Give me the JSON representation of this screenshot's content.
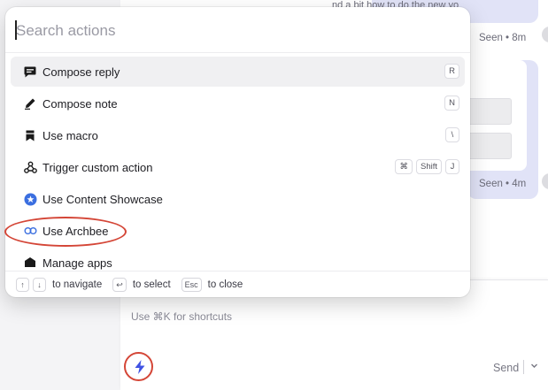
{
  "background": {
    "message_top_text": "nd a bit how to do the new yo",
    "seen_1": "Seen • 8m",
    "seen_2": "Seen • 4m",
    "composer_hint": "Use ⌘K for shortcuts",
    "send_label": "Send",
    "accent_color": "#3f52e3"
  },
  "palette": {
    "search_placeholder": "Search actions",
    "items": [
      {
        "label": "Compose reply",
        "icon": "compose-reply-icon",
        "keys": [
          "R"
        ]
      },
      {
        "label": "Compose note",
        "icon": "compose-note-icon",
        "keys": [
          "N"
        ]
      },
      {
        "label": "Use macro",
        "icon": "bookmark-icon",
        "keys": [
          "\\"
        ]
      },
      {
        "label": "Trigger custom action",
        "icon": "webhook-icon",
        "keys": [
          "⌘",
          "Shift",
          "J"
        ]
      },
      {
        "label": "Use Content Showcase",
        "icon": "content-showcase-icon",
        "keys": []
      },
      {
        "label": "Use Archbee",
        "icon": "archbee-icon",
        "keys": []
      },
      {
        "label": "Manage apps",
        "icon": "apps-icon",
        "keys": []
      }
    ],
    "footer": {
      "navigate_keys": [
        "↑",
        "↓"
      ],
      "navigate_label": "to navigate",
      "select_key": "↩",
      "select_label": "to select",
      "close_key": "Esc",
      "close_label": "to close"
    }
  }
}
